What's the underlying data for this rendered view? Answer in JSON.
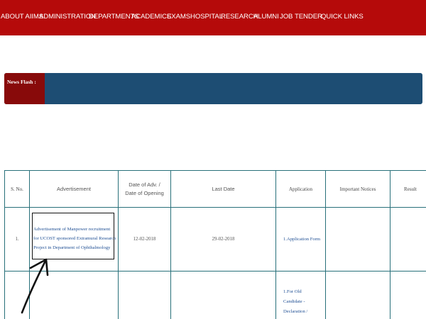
{
  "nav": {
    "items": [
      "ABOUT AIIMS",
      "ADMINISTRATION",
      "DEPARTMENTS",
      "ACADEMICS",
      "EXAMS",
      "HOSPITAL",
      "RESEARCH",
      "ALUMNI",
      "JOB",
      "TENDER",
      "QUICK LINKS"
    ]
  },
  "news_flash": {
    "label": "News Flash :"
  },
  "table": {
    "headers": {
      "sno": "S. No.",
      "advertisement": "Advertisement",
      "date_adv_line1": "Date of Adv. /",
      "date_adv_line2": "Date of Opening",
      "last_date": "Last Date",
      "application": "Application",
      "important_notices": "Important Notices",
      "result": "Result"
    },
    "rows": [
      {
        "sno": "1.",
        "advertisement": "Advertisement of Manpower recruitment for UCOST sponsored Extramural Research Project in Department of Ophthalmology",
        "date_adv": "12-02-2018",
        "last_date": "29-02-2018",
        "application": "1.Application Form",
        "important_notices": "",
        "result": ""
      },
      {
        "sno": "",
        "advertisement": "",
        "date_adv": "",
        "last_date": "",
        "application": "1.For Old Candidate - Declaration /",
        "important_notices": "",
        "result": ""
      }
    ]
  },
  "colors": {
    "nav_bg": "#b50a0a",
    "news_bg": "#1d4d73",
    "news_label_bg": "#880a0a",
    "table_border": "#28707a",
    "link": "#1f4f94"
  }
}
